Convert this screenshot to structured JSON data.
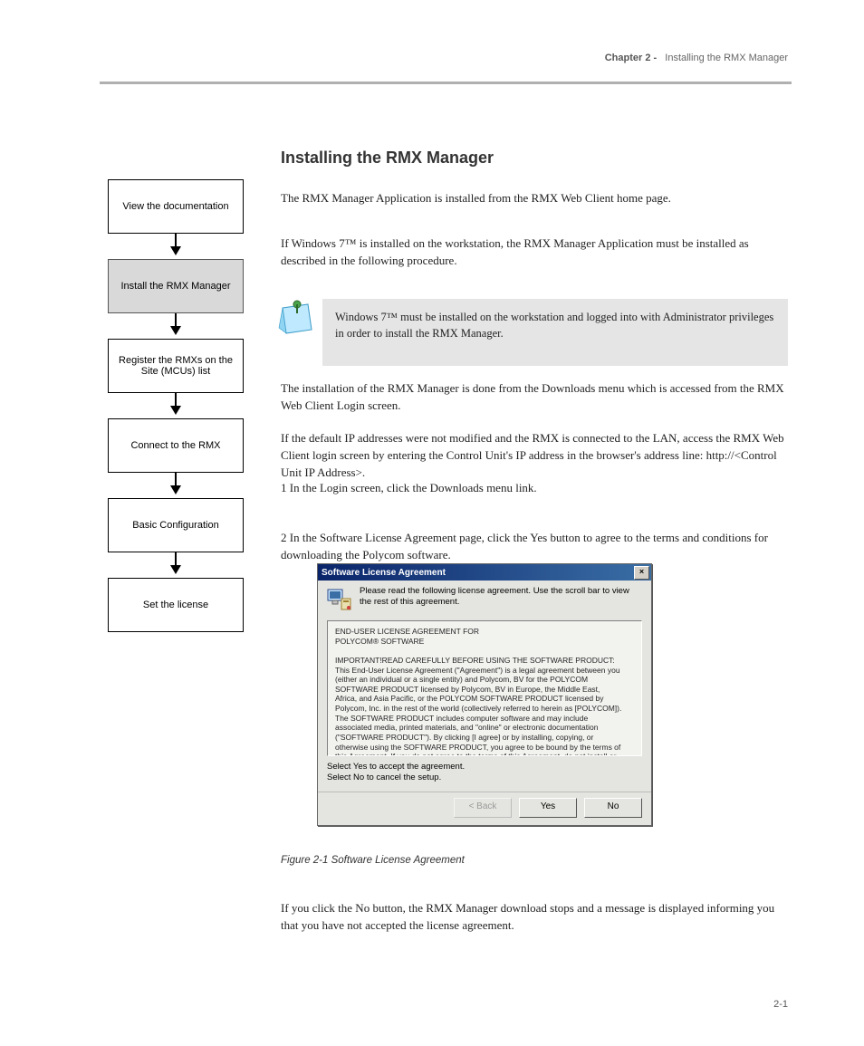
{
  "chapter": {
    "prefix": "Chapter 2 -",
    "title": "Installing the RMX Manager"
  },
  "section_heading": "Installing the RMX Manager",
  "intro_line1": "The RMX Manager Application is installed from the RMX Web Client home page.",
  "intro_line2": "If Windows 7™ is installed on the workstation, the RMX Manager Application must be installed as described in the following procedure.",
  "flow": [
    {
      "label": "View the documentation"
    },
    {
      "label": "Install the RMX Manager"
    },
    {
      "label": "Register the RMXs on the Site (MCUs) list"
    },
    {
      "label": "Connect to the RMX"
    },
    {
      "label": "Basic Configuration"
    },
    {
      "label": "Set the license"
    }
  ],
  "note_text": "Windows 7™ must be installed on the workstation and logged into with Administrator privileges in order to install the RMX Manager.",
  "body3": "The installation of the RMX Manager is done from the Downloads menu which is accessed from the RMX Web Client Login screen.",
  "body4": "If the default IP addresses were not modified and the RMX is connected to the LAN, access the RMX Web Client login screen by entering the Control Unit's IP address in the browser's address line: http://<Control Unit IP Address>.",
  "body5": "1   In the Login screen, click the Downloads menu link.",
  "body6": "2   In the Software License Agreement page, click the Yes button to agree to the terms and conditions for downloading the Polycom software.",
  "dialog": {
    "title": "Software License Agreement",
    "top_text": "Please read the following license agreement. Use the scroll bar to view the rest of this agreement.",
    "license_header1": "END-USER LICENSE AGREEMENT FOR",
    "license_header2": "POLYCOM® SOFTWARE",
    "license_body": "IMPORTANT!READ CAREFULLY BEFORE USING THE SOFTWARE PRODUCT: This End-User License Agreement (\"Agreement\") is a legal agreement between you (either an individual or a single entity) and Polycom, BV for the POLYCOM SOFTWARE PRODUCT licensed by Polycom, BV in Europe, the Middle East, Africa, and Asia Pacific, or the POLYCOM SOFTWARE PRODUCT licensed by Polycom, Inc. in the rest of the world (collectively referred to herein as [POLYCOM]). The SOFTWARE PRODUCT includes computer software and may include associated media, printed materials, and \"online\" or electronic documentation (\"SOFTWARE PRODUCT\"). By clicking [I agree] or by installing, copying, or otherwise using the SOFTWARE PRODUCT, you agree to be bound by the terms of this Agreement. If you do not agree to the terms of this Agreement, do not install or use the SOFTWARE PRODUCT, and return it to your place of purchase",
    "select_note": "Select Yes to accept the agreement.\nSelect No to cancel the setup.",
    "btn_back": "< Back",
    "btn_yes": "Yes",
    "btn_no": "No"
  },
  "dialog_caption": "Figure 2-1   Software License Agreement",
  "body7": "If you click the No button, the RMX Manager download stops and a message is displayed informing you that you have not accepted the license agreement.",
  "footer_page": "2-1"
}
